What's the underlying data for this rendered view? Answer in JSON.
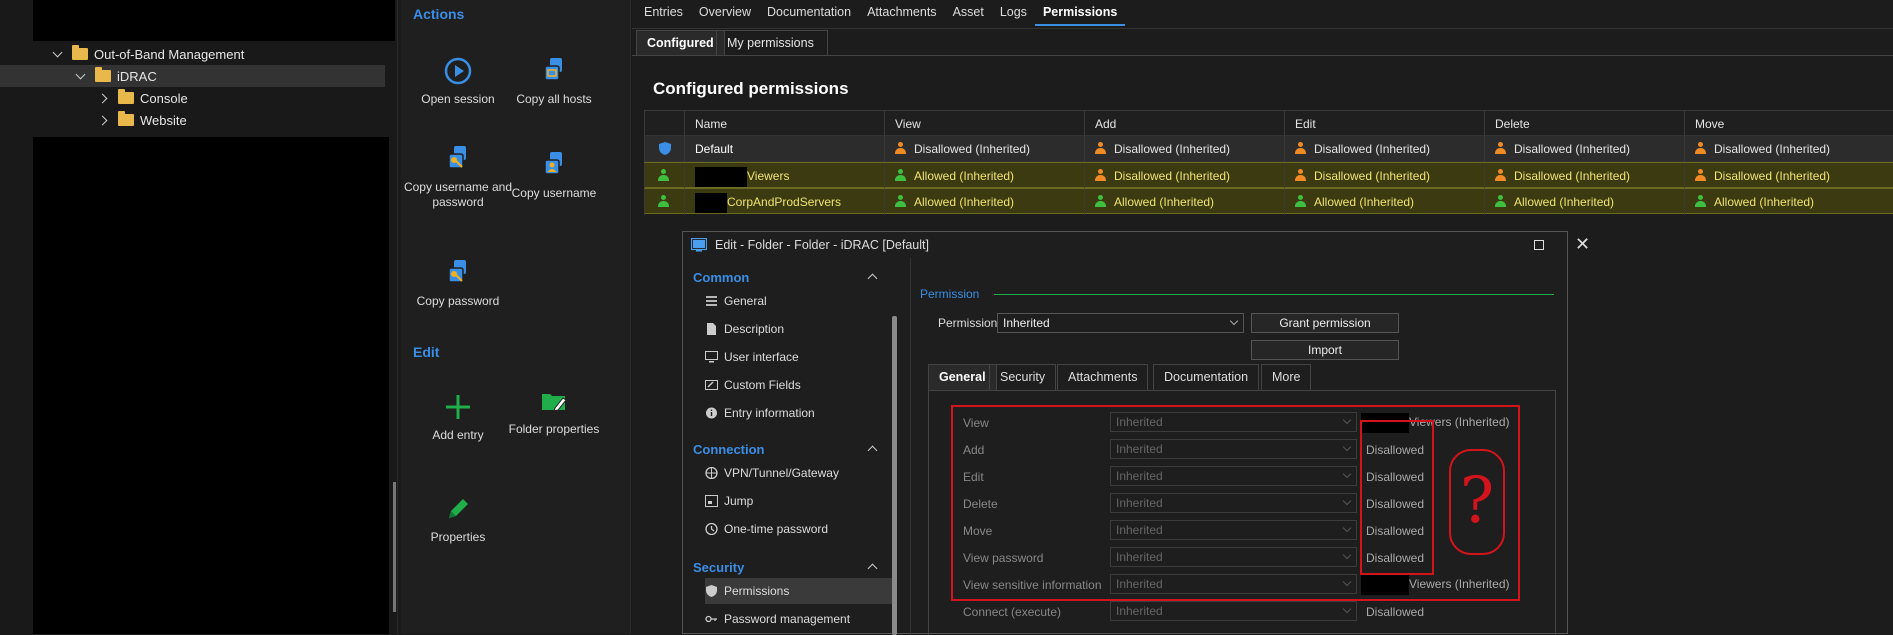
{
  "tree": {
    "items": [
      {
        "label": "Out-of-Band Management",
        "expanded": true
      },
      {
        "label": "iDRAC",
        "expanded": true,
        "selected": true
      },
      {
        "label": "Console",
        "expanded": false
      },
      {
        "label": "Website",
        "expanded": false
      }
    ]
  },
  "actions": {
    "section_actions": "Actions",
    "section_edit": "Edit",
    "open_session": "Open session",
    "copy_all_hosts": "Copy all hosts",
    "copy_username_password": "Copy username and password",
    "copy_username": "Copy username",
    "copy_password": "Copy password",
    "add_entry": "Add entry",
    "folder_properties": "Folder properties",
    "properties": "Properties"
  },
  "main": {
    "tabs": [
      "Entries",
      "Overview",
      "Documentation",
      "Attachments",
      "Asset",
      "Logs",
      "Permissions"
    ],
    "active_tab": "Permissions",
    "subtabs": [
      "Configured",
      "My permissions"
    ],
    "title": "Configured permissions"
  },
  "perm_table": {
    "headers": [
      "Name",
      "View",
      "Add",
      "Edit",
      "Delete",
      "Move"
    ],
    "rows": [
      {
        "name": "Default",
        "cells": [
          "Disallowed (Inherited)",
          "Disallowed (Inherited)",
          "Disallowed (Inherited)",
          "Disallowed (Inherited)",
          "Disallowed (Inherited)"
        ],
        "status": [
          "orange",
          "orange",
          "orange",
          "orange",
          "orange"
        ]
      },
      {
        "name": "Viewers",
        "cells": [
          "Allowed (Inherited)",
          "Disallowed (Inherited)",
          "Disallowed (Inherited)",
          "Disallowed (Inherited)",
          "Disallowed (Inherited)"
        ],
        "status": [
          "green",
          "orange",
          "orange",
          "orange",
          "orange"
        ]
      },
      {
        "name": "CorpAndProdServers",
        "cells": [
          "Allowed (Inherited)",
          "Allowed (Inherited)",
          "Allowed (Inherited)",
          "Allowed (Inherited)",
          "Allowed (Inherited)"
        ],
        "status": [
          "green",
          "green",
          "green",
          "green",
          "green"
        ]
      }
    ]
  },
  "dialog": {
    "title": "Edit - Folder - Folder - iDRAC [Default]",
    "categories": [
      {
        "label": "Common",
        "items": [
          "General",
          "Description",
          "User interface",
          "Custom Fields",
          "Entry information"
        ]
      },
      {
        "label": "Connection",
        "items": [
          "VPN/Tunnel/Gateway",
          "Jump",
          "One-time password"
        ]
      },
      {
        "label": "Security",
        "items": [
          "Permissions",
          "Password management"
        ]
      }
    ],
    "permission_section": "Permission",
    "permissions_label": "Permissions",
    "permissions_value": "Inherited",
    "grant_button": "Grant permission",
    "import_button": "Import",
    "tabs": [
      "General",
      "Security",
      "Attachments",
      "Documentation",
      "More"
    ],
    "fields": [
      {
        "label": "View",
        "value": "Inherited",
        "result": "Viewers (Inherited)"
      },
      {
        "label": "Add",
        "value": "Inherited",
        "result": "Disallowed"
      },
      {
        "label": "Edit",
        "value": "Inherited",
        "result": "Disallowed"
      },
      {
        "label": "Delete",
        "value": "Inherited",
        "result": "Disallowed"
      },
      {
        "label": "Move",
        "value": "Inherited",
        "result": "Disallowed"
      },
      {
        "label": "View password",
        "value": "Inherited",
        "result": "Disallowed"
      },
      {
        "label": "View sensitive information",
        "value": "Inherited",
        "result": "Viewers (Inherited)"
      },
      {
        "label": "Connect (execute)",
        "value": "Inherited",
        "result": "Disallowed"
      }
    ],
    "annotation": "?"
  },
  "colors": {
    "accent": "#3a8ee6",
    "disallowed": "#f08a24",
    "allowed": "#3fbf3f",
    "highlight_text": "#f1e56e",
    "annotation_red": "#d4141c"
  }
}
